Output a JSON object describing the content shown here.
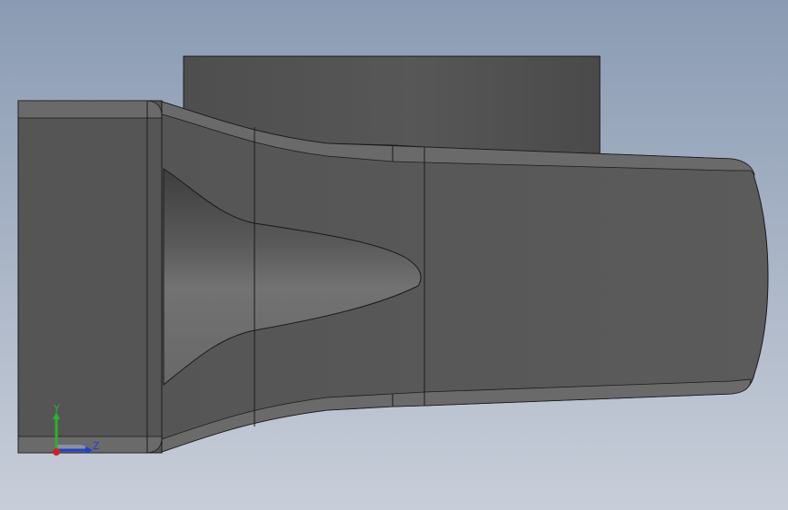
{
  "viewport": {
    "background_top": "#8a9bb3",
    "background_bottom": "#c8ced9"
  },
  "model": {
    "face_color_main": "#585858",
    "face_color_dark": "#4a4a4a",
    "face_color_light": "#6e6e6e",
    "edge_color": "#1a1a1a"
  },
  "triad": {
    "y_label": "Y",
    "z_label": "Z",
    "y_color": "#2bb32b",
    "z_color": "#1f3fd6",
    "x_color": "#d02020"
  }
}
